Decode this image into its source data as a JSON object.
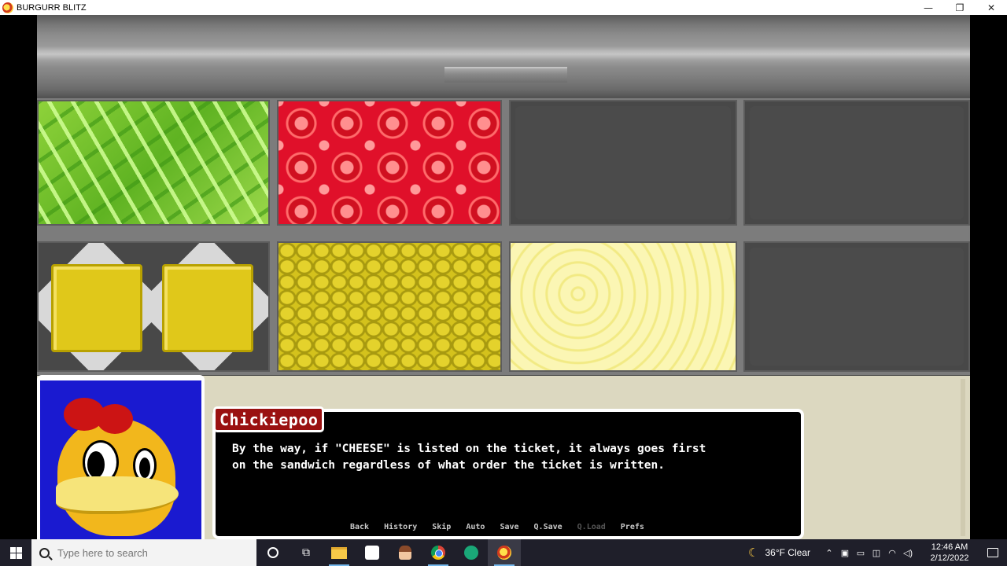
{
  "window": {
    "title": "BURGURR BLITZ",
    "controls": {
      "minimize": "—",
      "restore": "❐",
      "close": "✕"
    }
  },
  "game": {
    "ingredients": [
      {
        "name": "lettuce",
        "filled": true
      },
      {
        "name": "tomato",
        "filled": true
      },
      {
        "name": "empty",
        "filled": false
      },
      {
        "name": "empty",
        "filled": false
      },
      {
        "name": "cheese",
        "filled": true
      },
      {
        "name": "pickle",
        "filled": true
      },
      {
        "name": "onion",
        "filled": true
      },
      {
        "name": "empty",
        "filled": false
      }
    ],
    "dialogue": {
      "speaker": "Chickiepoo",
      "line1": "By the way, if \"CHEESE\" is listed on the ticket, it always goes first",
      "line2": "on the sandwich regardless of what order the ticket is written."
    },
    "quick_menu": {
      "back": "Back",
      "history": "History",
      "skip": "Skip",
      "auto": "Auto",
      "save": "Save",
      "qsave": "Q.Save",
      "qload": "Q.Load",
      "prefs": "Prefs"
    }
  },
  "taskbar": {
    "search_placeholder": "Type here to search",
    "weather": "36°F  Clear",
    "time": "12:46 AM",
    "date": "2/12/2022",
    "icons": [
      "start-icon",
      "cortana-icon",
      "task-view-icon",
      "file-explorer-icon",
      "chat-app-icon",
      "character-app-icon",
      "chrome-icon",
      "green-app-icon",
      "burgurr-blitz-icon"
    ]
  }
}
